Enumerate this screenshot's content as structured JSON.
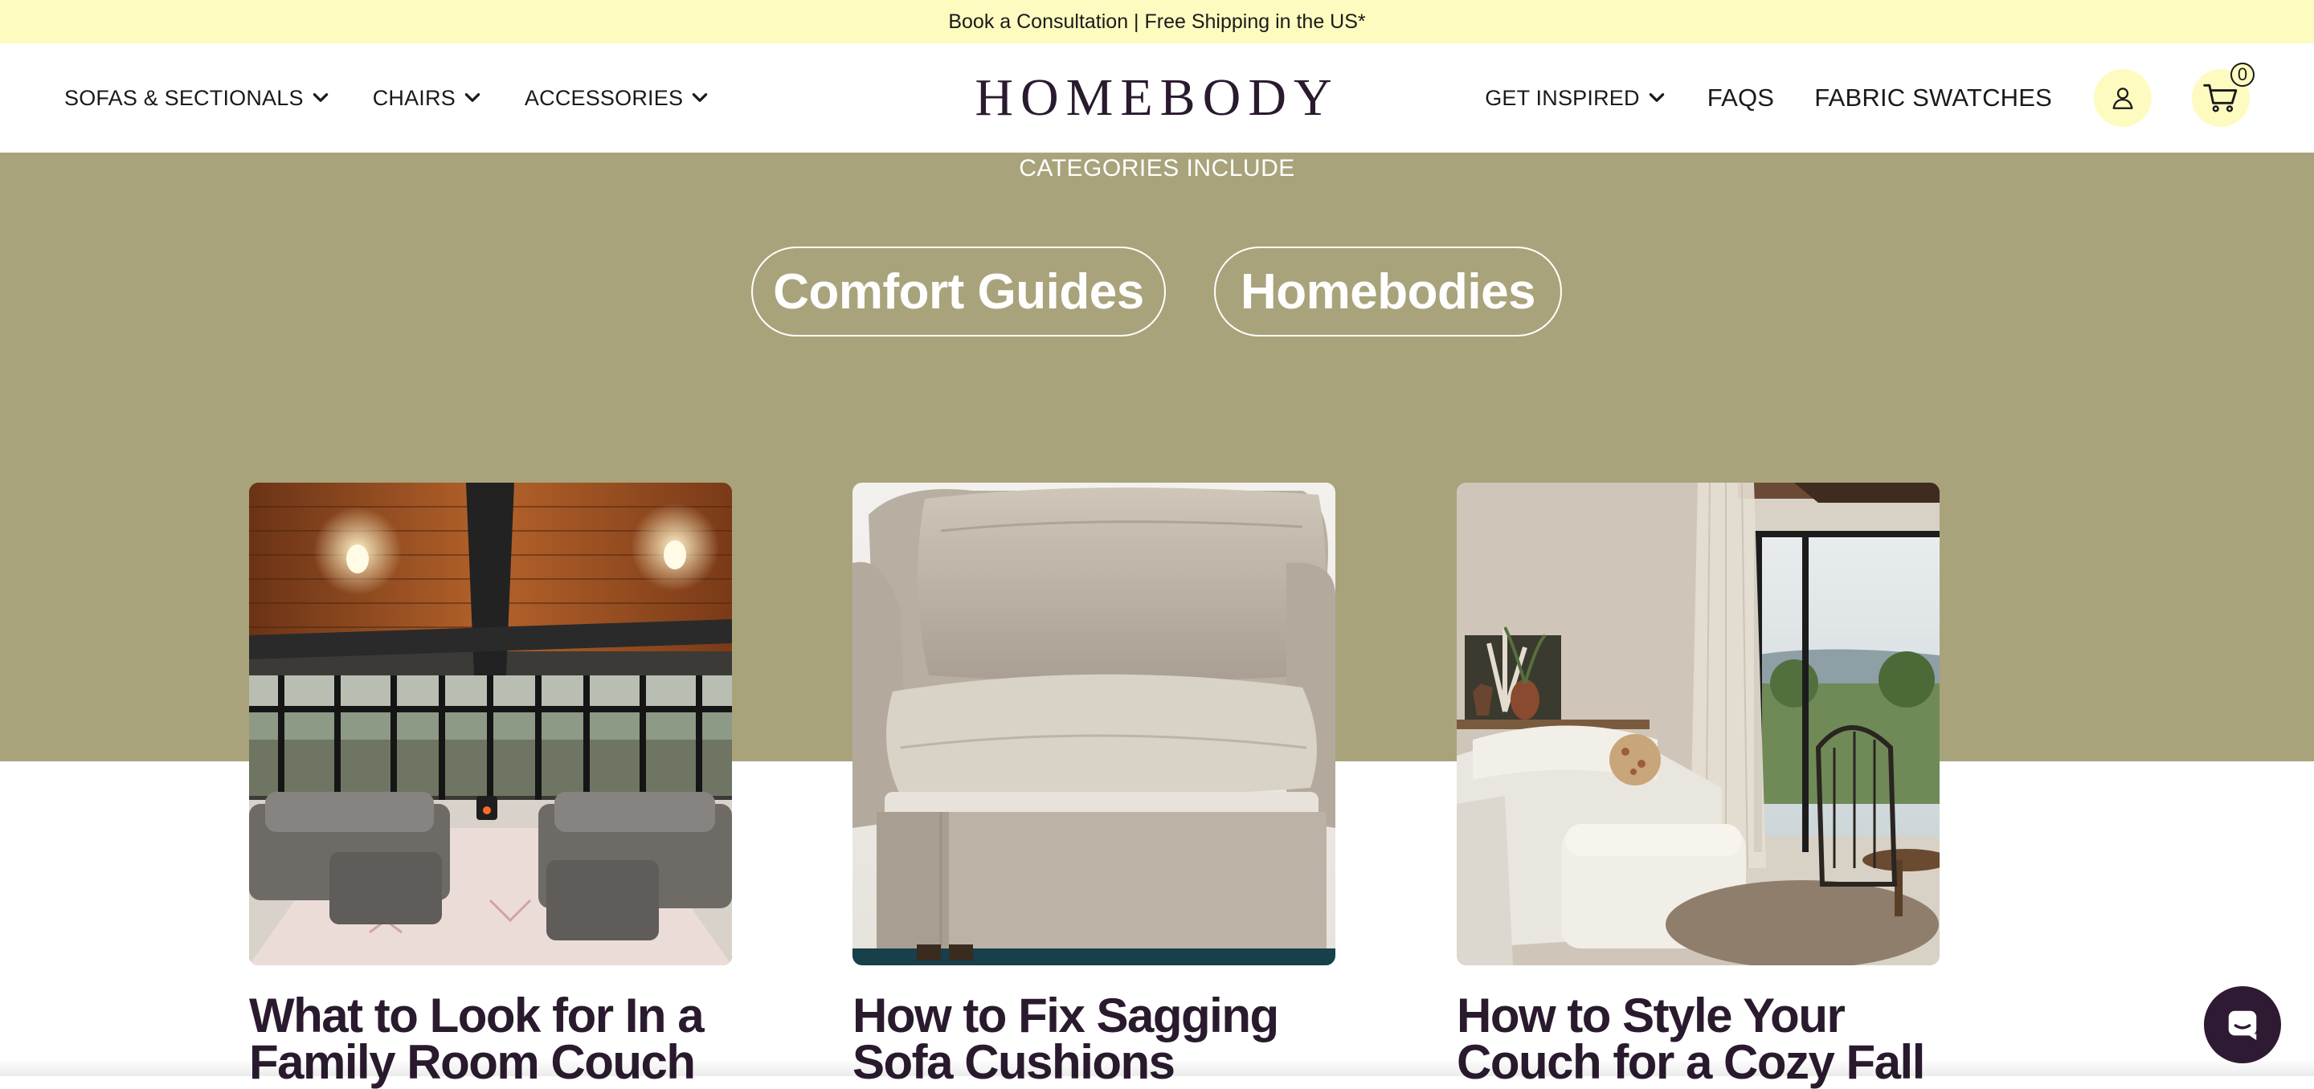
{
  "announcement": {
    "text": "Book a Consultation | Free Shipping in the US*"
  },
  "header": {
    "logo": "HOMEBODY",
    "nav_left": [
      {
        "label": "SOFAS & SECTIONALS",
        "icon": "chevron-down-icon"
      },
      {
        "label": "CHAIRS",
        "icon": "chevron-down-icon"
      },
      {
        "label": "ACCESSORIES",
        "icon": "chevron-down-icon"
      }
    ],
    "nav_right": [
      {
        "label": "GET INSPIRED",
        "icon": "chevron-down-icon"
      },
      {
        "label": "FAQS"
      },
      {
        "label": "FABRIC SWATCHES"
      }
    ],
    "account_icon": "user-icon",
    "cart_icon": "cart-icon",
    "cart_count": "0"
  },
  "categories": {
    "heading": "CATEGORIES INCLUDE",
    "pills": [
      "Comfort Guides",
      "Homebodies"
    ]
  },
  "articles": [
    {
      "title": "What to Look for In a Family Room Couch",
      "image": "sunroom-sectionals-photo"
    },
    {
      "title": "How to Fix Sagging Sofa Cushions",
      "image": "beige-sofa-seat-photo"
    },
    {
      "title": "How to Style Your Couch for a Cozy Fall",
      "image": "white-sofa-living-room-photo"
    }
  ],
  "chat": {
    "icon": "chat-icon"
  },
  "colors": {
    "announcement_bg": "#fdfbbf",
    "olive_band": "#a9a37b",
    "brand_text": "#2a1a2e",
    "chat_bg": "#2f1a33"
  }
}
